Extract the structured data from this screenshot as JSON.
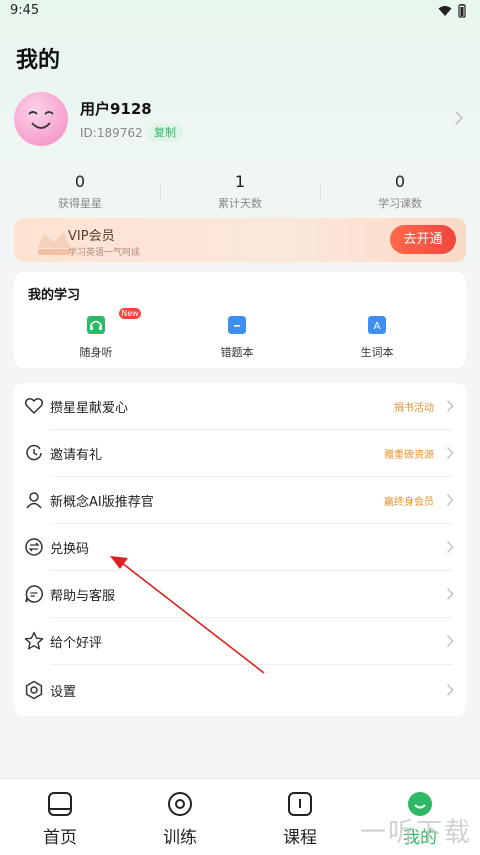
{
  "status": {
    "time": "9:45"
  },
  "title": "我的",
  "profile": {
    "username": "用户9128",
    "id": "ID:189762",
    "copy_label": "复制"
  },
  "stats": [
    {
      "value": "0",
      "label": "获得星星"
    },
    {
      "value": "1",
      "label": "累计天数"
    },
    {
      "value": "0",
      "label": "学习课数"
    }
  ],
  "vip": {
    "title": "VIP会员",
    "subtitle": "学习英语一气呵成",
    "button": "去开通"
  },
  "study": {
    "title": "我的学习",
    "badge": "New",
    "items": [
      {
        "label": "随身听",
        "icon": "headphones-icon",
        "color": "#2fb865"
      },
      {
        "label": "错题本",
        "icon": "notebook-icon",
        "color": "#3f8ef0"
      },
      {
        "label": "生词本",
        "icon": "vocabulary-icon",
        "color": "#3f8ef0"
      }
    ]
  },
  "menu": [
    {
      "label": "攒星星献爱心",
      "tag": "捐书活动",
      "icon": "heart-icon"
    },
    {
      "label": "邀请有礼",
      "tag": "赠重磅资源",
      "icon": "invite-icon"
    },
    {
      "label": "新概念AI版推荐官",
      "tag": "赢终身会员",
      "icon": "user-icon"
    },
    {
      "label": "兑换码",
      "tag": "",
      "icon": "exchange-icon"
    },
    {
      "label": "帮助与客服",
      "tag": "",
      "icon": "help-chat-icon"
    },
    {
      "label": "给个好评",
      "tag": "",
      "icon": "star-icon"
    },
    {
      "label": "设置",
      "tag": "",
      "icon": "settings-icon"
    }
  ],
  "tabs": [
    {
      "label": "首页",
      "icon": "home-icon"
    },
    {
      "label": "训练",
      "icon": "training-icon"
    },
    {
      "label": "课程",
      "icon": "course-icon"
    },
    {
      "label": "我的",
      "icon": "profile-face-icon",
      "active": true
    }
  ],
  "watermark": "一听下载",
  "colors": {
    "accent": "#2fb865",
    "vip_button": "#f0463d",
    "tag": "#e6912c",
    "arrow": "#e02020"
  }
}
